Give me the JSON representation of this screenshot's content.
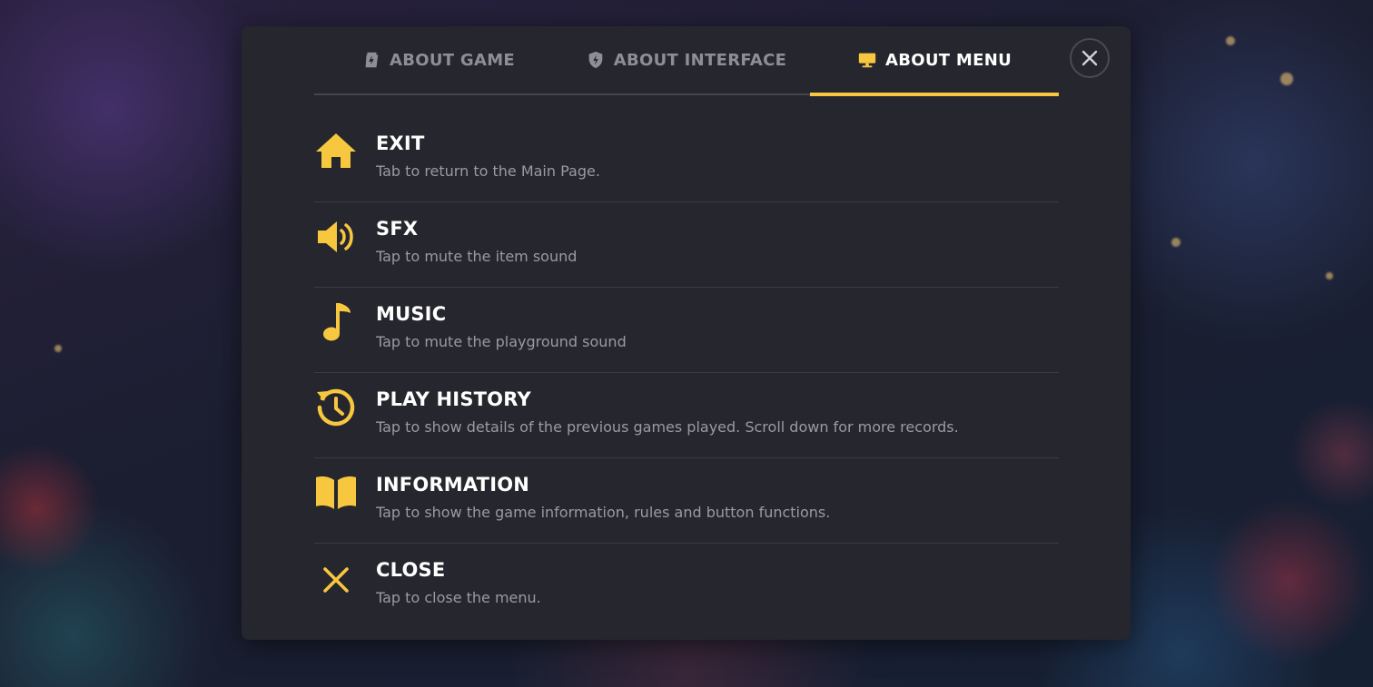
{
  "tabs": [
    {
      "label": "ABOUT GAME",
      "icon": "tag-icon",
      "active": false
    },
    {
      "label": "ABOUT INTERFACE",
      "icon": "shield-icon",
      "active": false
    },
    {
      "label": "ABOUT MENU",
      "icon": "monitor-icon",
      "active": true
    }
  ],
  "menu_items": [
    {
      "title": "EXIT",
      "description": "Tab to return to the Main Page.",
      "icon": "home-icon"
    },
    {
      "title": "SFX",
      "description": "Tap to mute the item sound",
      "icon": "speaker-icon"
    },
    {
      "title": "MUSIC",
      "description": "Tap to mute the playground sound",
      "icon": "music-note-icon"
    },
    {
      "title": "PLAY HISTORY",
      "description": "Tap to show details of the previous games played. Scroll down for more records.",
      "icon": "history-icon"
    },
    {
      "title": "INFORMATION",
      "description": "Tap to show the game information, rules and button functions.",
      "icon": "book-icon"
    },
    {
      "title": "CLOSE",
      "description": "Tap to close the menu.",
      "icon": "close-icon"
    }
  ],
  "colors": {
    "accent": "#f7c73f",
    "panel": "#26262e",
    "text_primary": "#ffffff",
    "text_secondary": "#9a9aa2",
    "tab_inactive": "#8e8e96"
  }
}
